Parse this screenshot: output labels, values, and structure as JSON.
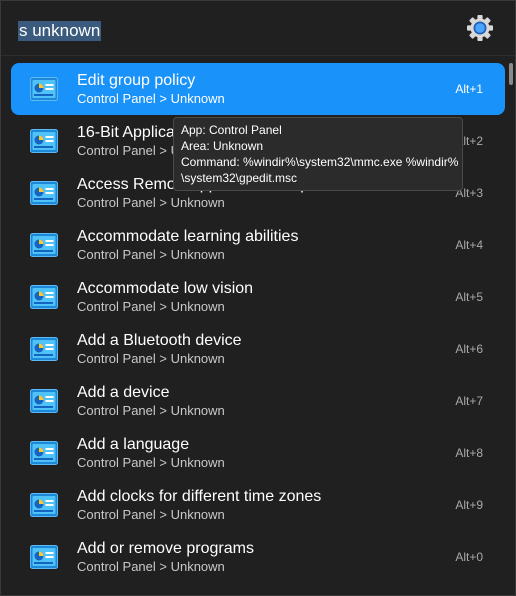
{
  "search": {
    "query": "s unknown"
  },
  "settings_icon": "gear-icon",
  "results": [
    {
      "title": "Edit group policy",
      "subtitle": "Control Panel > Unknown",
      "hotkey": "Alt+1",
      "icon": "control-panel-icon",
      "selected": true
    },
    {
      "title": "16-Bit Application Support",
      "subtitle": "Control Panel > Unknown",
      "hotkey": "Alt+2",
      "icon": "control-panel-icon"
    },
    {
      "title": "Access RemoteApp and desktops",
      "subtitle": "Control Panel > Unknown",
      "hotkey": "Alt+3",
      "icon": "control-panel-icon"
    },
    {
      "title": "Accommodate learning abilities",
      "subtitle": "Control Panel > Unknown",
      "hotkey": "Alt+4",
      "icon": "control-panel-icon"
    },
    {
      "title": "Accommodate low vision",
      "subtitle": "Control Panel > Unknown",
      "hotkey": "Alt+5",
      "icon": "control-panel-icon"
    },
    {
      "title": "Add a Bluetooth device",
      "subtitle": "Control Panel > Unknown",
      "hotkey": "Alt+6",
      "icon": "control-panel-icon"
    },
    {
      "title": "Add a device",
      "subtitle": "Control Panel > Unknown",
      "hotkey": "Alt+7",
      "icon": "control-panel-icon"
    },
    {
      "title": "Add a language",
      "subtitle": "Control Panel > Unknown",
      "hotkey": "Alt+8",
      "icon": "control-panel-icon"
    },
    {
      "title": "Add clocks for different time zones",
      "subtitle": "Control Panel > Unknown",
      "hotkey": "Alt+9",
      "icon": "control-panel-icon"
    },
    {
      "title": "Add or remove programs",
      "subtitle": "Control Panel > Unknown",
      "hotkey": "Alt+0",
      "icon": "control-panel-icon"
    }
  ],
  "tooltip": {
    "app": "App: Control Panel",
    "area": "Area: Unknown",
    "command_line1": "Command: %windir%\\system32\\mmc.exe %windir%",
    "command_line2": "\\system32\\gpedit.msc"
  },
  "colors": {
    "background": "#202020",
    "selected": "#1992f9",
    "text": "#ffffff",
    "subtext": "#c9c9c9"
  }
}
